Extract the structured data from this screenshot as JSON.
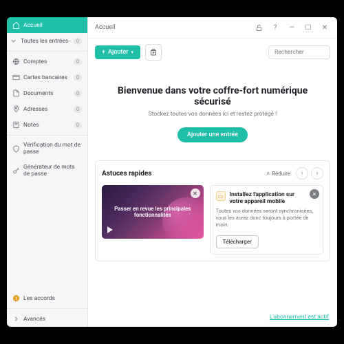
{
  "sidebar": {
    "items": [
      {
        "label": "Accueil",
        "count": null
      },
      {
        "label": "Toutes les entrées",
        "count": "0"
      },
      {
        "label": "Comptes",
        "count": "0"
      },
      {
        "label": "Cartes bancaires",
        "count": "0"
      },
      {
        "label": "Documents",
        "count": "0"
      },
      {
        "label": "Adresses",
        "count": "0"
      },
      {
        "label": "Notes",
        "count": "0"
      },
      {
        "label": "Vérification du mot de passe"
      },
      {
        "label": "Générateur de mots de passe"
      }
    ],
    "bottom": [
      {
        "label": "Les accords"
      },
      {
        "label": "Avancés"
      }
    ]
  },
  "titlebar": {
    "title": "Accueil"
  },
  "toolbar": {
    "add_label": "Ajouter",
    "search_placeholder": "Rechercher"
  },
  "hero": {
    "title": "Bienvenue dans votre coffre-fort numérique sécurisé",
    "subtitle": "Stockez toutes vos données ici et restez protégé !",
    "cta": "Ajouter une entrée"
  },
  "tips": {
    "title": "Astuces rapides",
    "toggle": "Réduire",
    "video_text": "Passer en revue les principales fonctionnalités",
    "install": {
      "title": "Installez l'application sur votre appareil mobile",
      "body": "Toutes vos données seront synchronisées, vous les aurez donc toujours à portée de main.",
      "cta": "Télécharger"
    }
  },
  "footer": {
    "status": "L'abonnement est actif"
  }
}
